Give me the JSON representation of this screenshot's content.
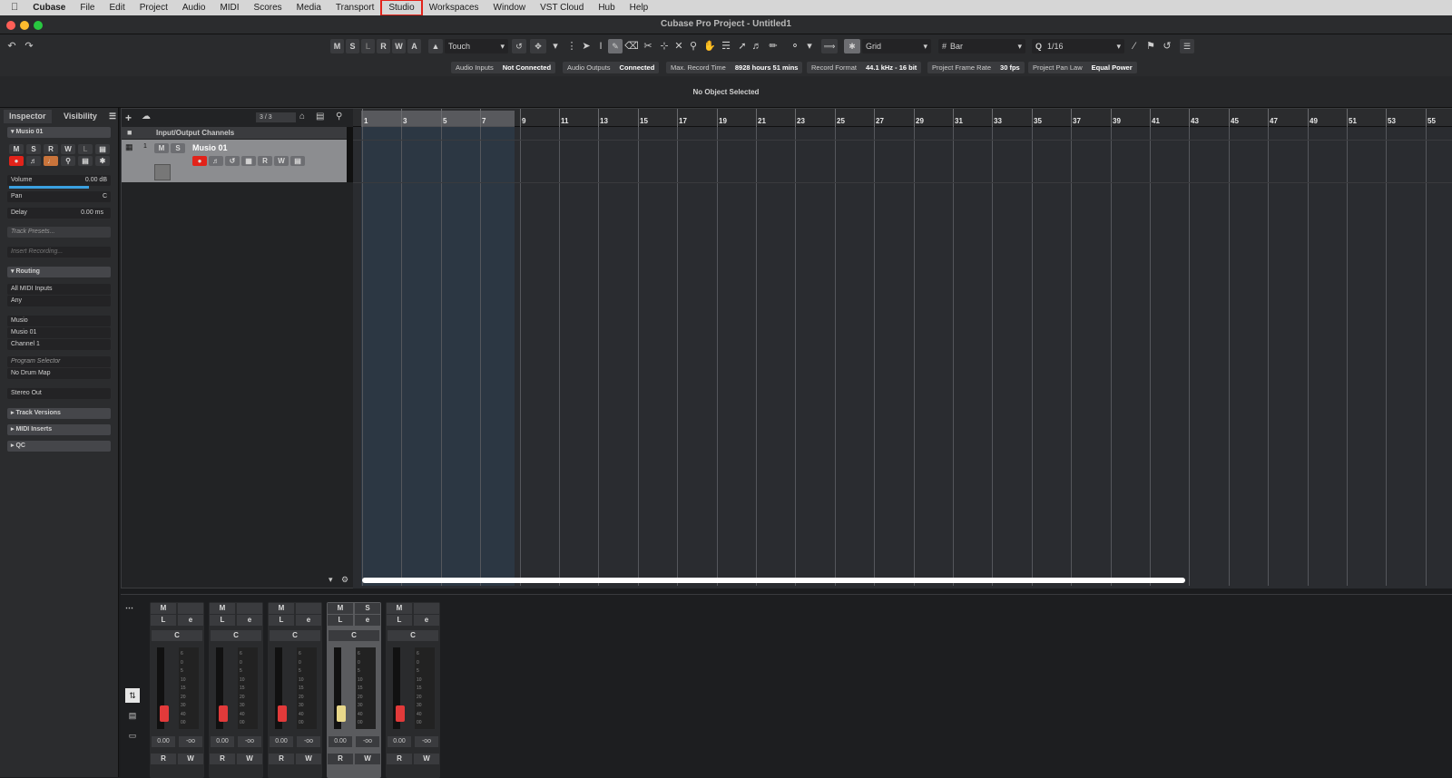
{
  "menubar": {
    "apple": "",
    "app_name": "Cubase",
    "items": [
      "File",
      "Edit",
      "Project",
      "Audio",
      "MIDI",
      "Scores",
      "Media",
      "Transport",
      "Studio",
      "Workspaces",
      "Window",
      "VST Cloud",
      "Hub",
      "Help"
    ],
    "highlighted": "Studio"
  },
  "window": {
    "title": "Cubase Pro Project - Untitled1"
  },
  "toolbar": {
    "mode_buttons": [
      "M",
      "S",
      "L",
      "R",
      "W",
      "A"
    ],
    "automation_mode": "Touch",
    "snap_type": "Grid",
    "grid_type": "Bar",
    "quantize": "1/16"
  },
  "infobar": {
    "audio_inputs_label": "Audio Inputs",
    "audio_inputs_value": "Not Connected",
    "audio_outputs_label": "Audio Outputs",
    "audio_outputs_value": "Connected",
    "max_record_label": "Max. Record Time",
    "max_record_value": "8928 hours 51 mins",
    "record_format_label": "Record Format",
    "record_format_value": "44.1 kHz - 16 bit",
    "frame_rate_label": "Project Frame Rate",
    "frame_rate_value": "30 fps",
    "pan_law_label": "Project Pan Law",
    "pan_law_value": "Equal Power"
  },
  "status": {
    "no_object": "No Object Selected"
  },
  "inspector": {
    "tab_inspector": "Inspector",
    "tab_visibility": "Visibility",
    "track_name": "Musio 01",
    "volume_label": "Volume",
    "volume_value": "0.00 dB",
    "pan_label": "Pan",
    "pan_value": "C",
    "delay_label": "Delay",
    "delay_value": "0.00 ms",
    "track_presets": "Track Presets...",
    "insert_recording": "Insert Recording...",
    "routing": "Routing",
    "midi_input": "All MIDI Inputs",
    "channel_any": "Any",
    "instrument": "Musio",
    "output": "Musio 01",
    "channel": "Channel 1",
    "program_selector": "Program Selector",
    "drum_map": "No Drum Map",
    "stereo_out": "Stereo Out",
    "track_versions": "Track Versions",
    "midi_inserts": "MIDI Inserts",
    "qc": "QC"
  },
  "tracklist": {
    "count": "3 / 3",
    "folder_name": "Input/Output Channels",
    "track_number": "1",
    "track_name": "Musio 01"
  },
  "ruler": {
    "bars": [
      "1",
      "3",
      "5",
      "7",
      "9",
      "11",
      "13",
      "15",
      "17",
      "19",
      "21",
      "23",
      "25",
      "27",
      "29",
      "31",
      "33",
      "35",
      "37",
      "39",
      "41",
      "43",
      "45",
      "47",
      "49",
      "51",
      "53",
      "55"
    ]
  },
  "mixer": {
    "strips": [
      {
        "value": "0.00",
        "peak": "-oo"
      },
      {
        "value": "0.00",
        "peak": "-oo"
      },
      {
        "value": "0.00",
        "peak": "-oo"
      },
      {
        "value": "0.00",
        "peak": "-oo"
      },
      {
        "value": "0.00",
        "peak": "-oo"
      }
    ],
    "pan": "C",
    "scale": [
      "6",
      "0",
      "5",
      "10",
      "15",
      "20",
      "30",
      "40",
      "00"
    ]
  }
}
